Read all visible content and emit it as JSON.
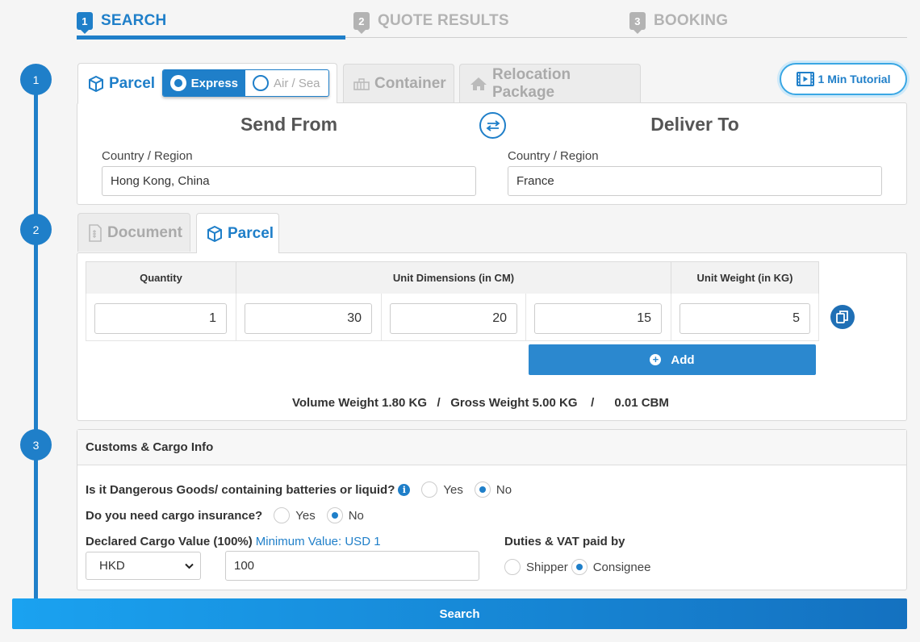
{
  "progress": {
    "steps": [
      {
        "num": "1",
        "label": "SEARCH"
      },
      {
        "num": "2",
        "label": "QUOTE RESULTS"
      },
      {
        "num": "3",
        "label": "BOOKING"
      }
    ]
  },
  "timeline": {
    "dots": [
      "1",
      "2",
      "3"
    ]
  },
  "mode_tabs": {
    "parcel": "Parcel",
    "container": "Container",
    "relocation": "Relocation Package"
  },
  "service_toggle": {
    "express": "Express",
    "air_sea": "Air / Sea"
  },
  "tutorial": {
    "label": "1 Min Tutorial"
  },
  "route": {
    "send_from_title": "Send From",
    "deliver_to_title": "Deliver To",
    "from_label": "Country / Region",
    "from_value": "Hong Kong, China",
    "to_label": "Country / Region",
    "to_value": "France"
  },
  "package_tabs": {
    "document": "Document",
    "parcel": "Parcel"
  },
  "dimensions": {
    "headers": {
      "quantity": "Quantity",
      "unit_dims": "Unit Dimensions (in CM)",
      "unit_weight": "Unit Weight (in KG)"
    },
    "row": {
      "quantity": "1",
      "length": "30",
      "width": "20",
      "height": "15",
      "weight": "5"
    },
    "add_label": "Add"
  },
  "totals": {
    "volume_label": "Volume Weight",
    "volume_value": "1.80 KG",
    "sep": "/",
    "gross_label": "Gross Weight",
    "gross_value": "5.00 KG",
    "cbm": "0.01 CBM"
  },
  "customs": {
    "title": "Customs & Cargo Info",
    "dangerous_q": "Is it Dangerous Goods/ containing batteries or liquid?",
    "dangerous_selected": "No",
    "insurance_q": "Do you need cargo insurance?",
    "insurance_selected": "No",
    "yes": "Yes",
    "no": "No",
    "declared_label": "Declared Cargo Value (100%)",
    "declared_min": "Minimum Value: USD 1",
    "currency": "HKD",
    "declared_value": "100",
    "duties_label": "Duties & VAT paid by",
    "shipper": "Shipper",
    "consignee": "Consignee",
    "duties_selected": "Consignee"
  },
  "search_button": "Search",
  "colors": {
    "primary": "#1f7fc9",
    "inactive": "#b3b3b3"
  }
}
